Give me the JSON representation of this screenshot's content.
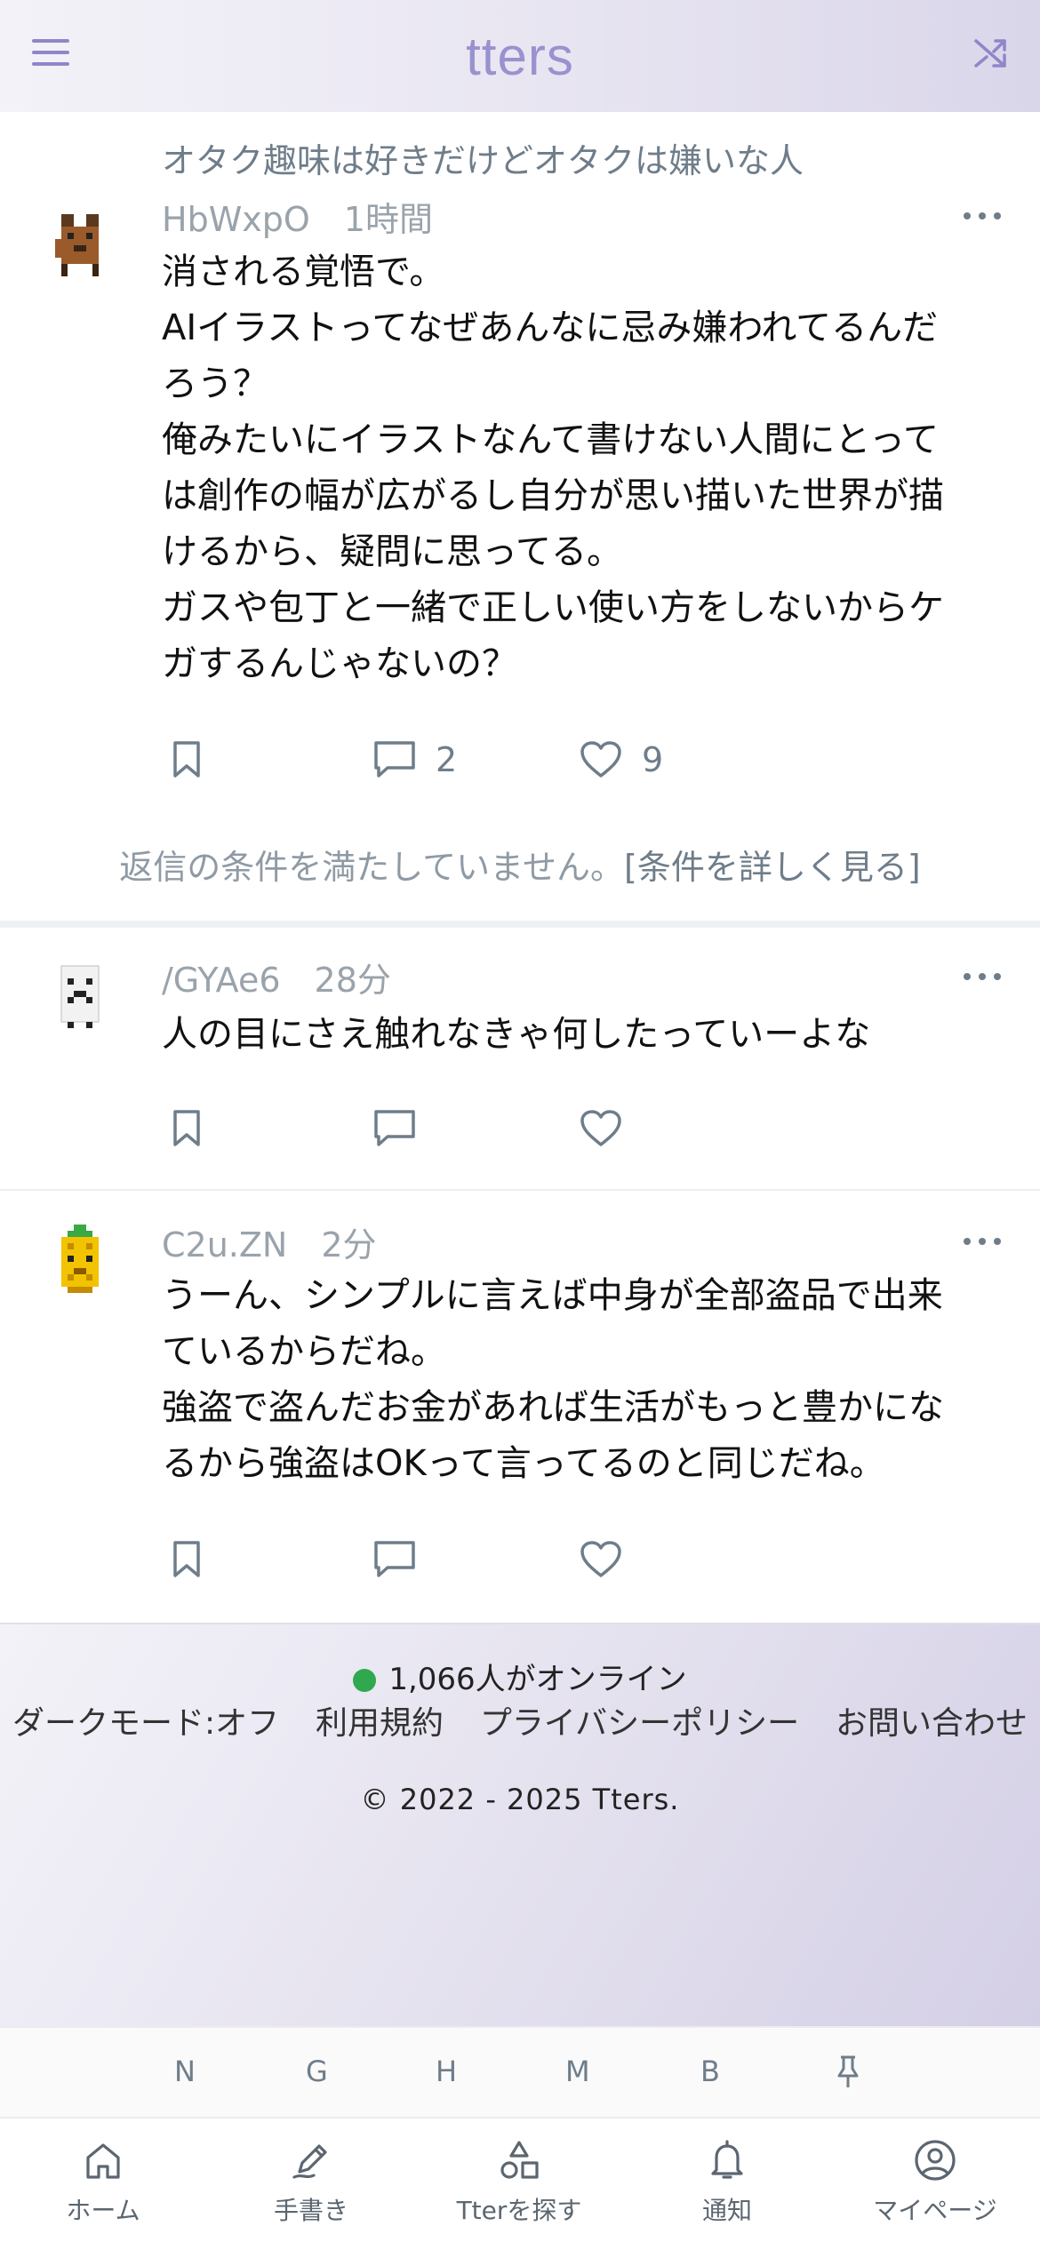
{
  "header": {
    "logo": "tters"
  },
  "posts": [
    {
      "topic": "オタク趣味は好きだけどオタクは嫌いな人",
      "user": "HbWxpO",
      "time": "1時間",
      "body": "消される覚悟で。\nAIイラストってなぜあんなに忌み嫌われてるんだろう？\n俺みたいにイラストなんて書けない人間にとっては創作の幅が広がるし自分が思い描いた世界が描けるから、疑問に思ってる。\nガスや包丁と一緒で正しい使い方をしないからケガするんじゃないの？",
      "replies": "2",
      "likes": "9",
      "avatar_icon": "brown-dog-avatar"
    },
    {
      "user": "/GYAe6",
      "time": "28分",
      "body": "人の目にさえ触れなきゃ何したっていーよな",
      "avatar_icon": "white-ghost-avatar"
    },
    {
      "user": "C2u.ZN",
      "time": "2分",
      "body": "うーん、シンプルに言えば中身が全部盗品で出来ているからだね。\n強盗で盗んだお金があれば生活がもっと豊かになるから強盗はOKって言ってるのと同じだね。",
      "avatar_icon": "pineapple-avatar"
    }
  ],
  "reply_condition": {
    "text": "返信の条件を満たしていません。",
    "link": "[条件を詳しく見る]"
  },
  "footer": {
    "online": "1,066人がオンライン",
    "links": [
      "ダークモード:オフ",
      "利用規約",
      "プライバシーポリシー",
      "お問い合わせ"
    ],
    "copyright": "© 2022 - 2025 Tters."
  },
  "shortcuts": [
    "N",
    "G",
    "H",
    "M",
    "B"
  ],
  "tabs": [
    {
      "label": "ホーム",
      "icon": "home-icon"
    },
    {
      "label": "手書き",
      "icon": "pen-icon"
    },
    {
      "label": "Tterを探す",
      "icon": "shapes-icon"
    },
    {
      "label": "通知",
      "icon": "bell-icon"
    },
    {
      "label": "マイページ",
      "icon": "user-circle-icon"
    }
  ],
  "colors": {
    "accent": "#9a92cf",
    "online_dot": "#2fa84f",
    "muted": "#6f7d8a"
  }
}
